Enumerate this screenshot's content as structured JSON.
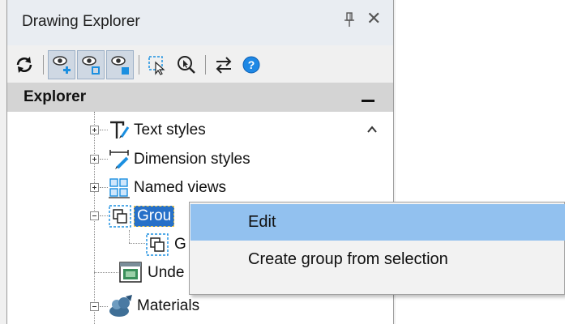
{
  "panel": {
    "title": "Drawing Explorer",
    "pin_label": "Auto Hide",
    "close_glyph": "✕"
  },
  "toolbar": {
    "buttons": [
      {
        "name": "refresh-icon"
      },
      {
        "name": "show-all-icon",
        "pressed": true
      },
      {
        "name": "show-selected-icon",
        "pressed": true
      },
      {
        "name": "show-filled-icon",
        "pressed": true
      },
      {
        "name": "select-icon"
      },
      {
        "name": "zoom-select-icon"
      },
      {
        "name": "swap-icon"
      },
      {
        "name": "help-icon"
      }
    ]
  },
  "explorer": {
    "title": "Explorer",
    "collapse_glyph": "–"
  },
  "tree": {
    "items": [
      {
        "label": "Text styles",
        "icon": "text-style-icon"
      },
      {
        "label": "Dimension styles",
        "icon": "dimension-style-icon"
      },
      {
        "label": "Named views",
        "icon": "named-views-icon"
      },
      {
        "label": "Grou",
        "icon": "groups-icon",
        "selected": true
      },
      {
        "label": "G",
        "icon": "group-icon"
      },
      {
        "label": "Unde",
        "icon": "underlay-icon"
      },
      {
        "label": "Materials",
        "icon": "materials-icon"
      }
    ]
  },
  "context_menu": {
    "items": [
      {
        "label": "Edit",
        "hover": true
      },
      {
        "label": "Create group from selection"
      }
    ]
  },
  "colors": {
    "selection": "#2670c8",
    "menu_hover": "#92c1ef",
    "titlebar": "#e9edf2",
    "header": "#d4d4d4"
  }
}
